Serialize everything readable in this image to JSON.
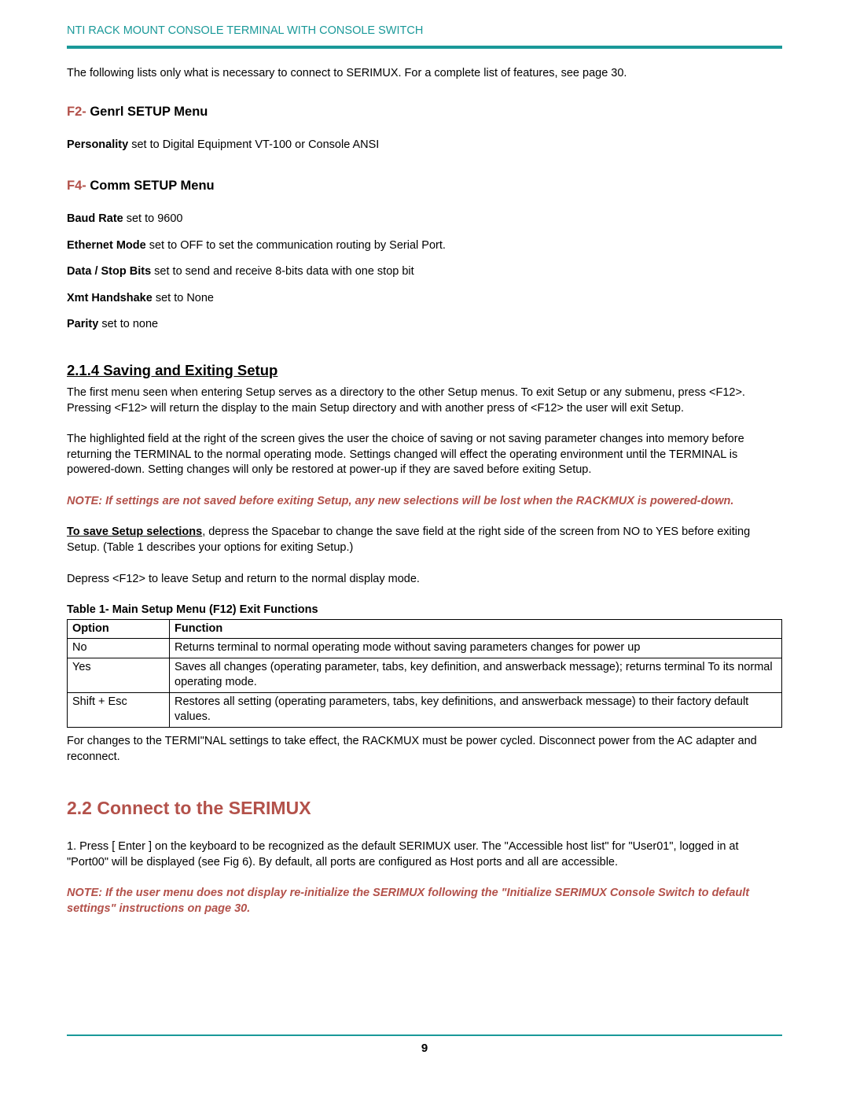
{
  "header": {
    "title": "NTI RACK MOUNT CONSOLE TERMINAL WITH CONSOLE SWITCH"
  },
  "intro": "The following lists only what is necessary to connect to SERIMUX.    For a complete list of features,  see page 30.",
  "f2": {
    "prefix": "F2-",
    "title": " Genrl SETUP Menu",
    "personality_label": "Personality",
    "personality_text": "  set to Digital Equipment VT-100 or  Console ANSI"
  },
  "f4": {
    "prefix": "F4-",
    "title": " Comm SETUP Menu",
    "baud_label": "Baud Rate",
    "baud_text": " set to 9600",
    "eth_label": "Ethernet Mode",
    "eth_text": " set to OFF to set the communication routing by Serial Port.",
    "data_label": "Data / Stop Bits",
    "data_text": " set to send and receive 8-bits data with one stop bit",
    "xmt_label": "Xmt Handshake",
    "xmt_text": " set to None",
    "parity_label": "Parity",
    "parity_text": " set to none"
  },
  "saving": {
    "heading": "2.1.4 Saving and Exiting Setup",
    "p1": "The first menu seen when entering Setup serves as a directory to the other Setup menus. To exit Setup or any submenu, press <F12>.    Pressing <F12> will return the display to the main Setup directory and with another press of <F12> the user will exit Setup.",
    "p2": "The highlighted field at the right of the screen gives the user the choice of saving or not saving parameter changes into memory before returning the TERMINAL to the normal operating mode.    Settings changed will effect the operating environment until the TERMINAL is powered-down. Setting changes will only be restored at power-up if they are saved before exiting Setup.",
    "note": "NOTE:  If settings are not saved before exiting Setup, any new selections will be lost when the RACKMUX is powered-down.",
    "save_label": "To save Setup selections",
    "save_text": ", depress the Spacebar to change the save field at the right side of the screen from NO to YES before exiting Setup. (Table 1 describes your options for exiting Setup.)",
    "p3": "Depress <F12> to leave Setup and return to the normal display mode.",
    "table_caption": "Table 1- Main Setup Menu (F12) Exit Functions",
    "table": {
      "h_option": "Option",
      "h_function": "Function",
      "rows": [
        {
          "option": "No",
          "function": "Returns terminal to normal operating mode without saving parameters changes for power up"
        },
        {
          "option": "Yes",
          "function": "Saves all changes (operating parameter, tabs, key definition, and answerback message); returns terminal To its normal operating mode."
        },
        {
          "option": "Shift + Esc",
          "function": "Restores all setting (operating parameters, tabs, key definitions, and answerback message) to their factory default values."
        }
      ]
    },
    "after_table": "For changes to the TERMI\"NAL settings to take effect, the RACKMUX must be power cycled.    Disconnect power from the AC adapter and reconnect."
  },
  "connect": {
    "heading": "2.2 Connect to the SERIMUX",
    "p1": "1.    Press [ Enter ] on the keyboard to be recognized as the default SERIMUX user. The \"Accessible host list\" for \"User01\", logged in at \"Port00\" will be displayed (see Fig 6).  By default, all ports are configured as Host ports and all are accessible.",
    "note": "NOTE:  If the user menu does not display re-initialize the SERIMUX following the \"Initialize SERIMUX Console Switch to default settings\" instructions on page 30."
  },
  "page_number": "9"
}
